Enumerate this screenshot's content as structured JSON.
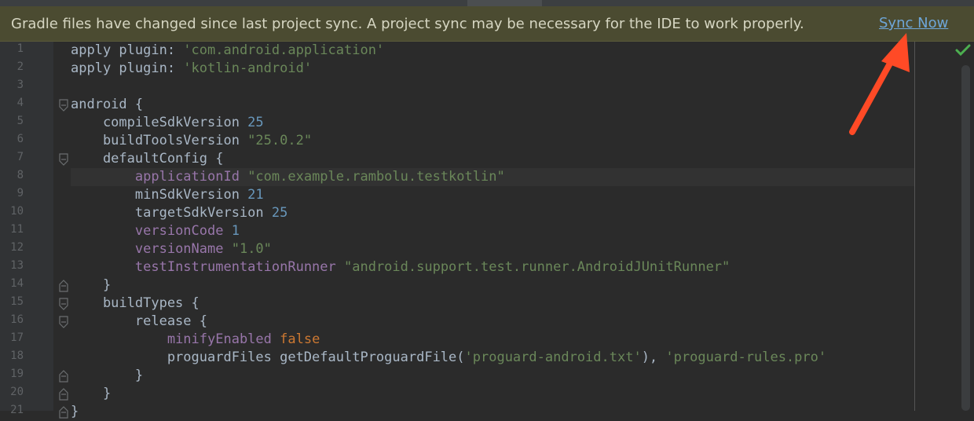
{
  "notification": {
    "message": "Gradle files have changed since last project sync. A project sync may be necessary for the IDE to work properly.",
    "action_label": "Sync Now"
  },
  "colors": {
    "keyword": "#cc7832",
    "string": "#6a8759",
    "number": "#6897bb",
    "property": "#9876aa",
    "plain": "#a9b7c6",
    "annotation_arrow": "#ff4a26"
  },
  "icons": {
    "status": "check-icon",
    "fold": "fold-marker-icon",
    "annotation": "red-arrow-icon"
  },
  "current_line": 8,
  "lines": [
    {
      "num": "1",
      "fold": "",
      "tokens": [
        {
          "t": "apply plugin: ",
          "c": ""
        },
        {
          "t": "'com.android.application'",
          "c": "str"
        }
      ]
    },
    {
      "num": "2",
      "fold": "",
      "tokens": [
        {
          "t": "apply plugin: ",
          "c": ""
        },
        {
          "t": "'kotlin-android'",
          "c": "str"
        }
      ]
    },
    {
      "num": "3",
      "fold": "",
      "tokens": []
    },
    {
      "num": "4",
      "fold": "open",
      "tokens": [
        {
          "t": "android {",
          "c": ""
        }
      ]
    },
    {
      "num": "5",
      "fold": "",
      "tokens": [
        {
          "t": "    compileSdkVersion ",
          "c": ""
        },
        {
          "t": "25",
          "c": "num"
        }
      ]
    },
    {
      "num": "6",
      "fold": "",
      "tokens": [
        {
          "t": "    buildToolsVersion ",
          "c": ""
        },
        {
          "t": "\"25.0.2\"",
          "c": "str"
        }
      ]
    },
    {
      "num": "7",
      "fold": "open",
      "tokens": [
        {
          "t": "    defaultConfig {",
          "c": ""
        }
      ]
    },
    {
      "num": "8",
      "fold": "",
      "tokens": [
        {
          "t": "        ",
          "c": ""
        },
        {
          "t": "applicationId ",
          "c": "prop"
        },
        {
          "t": "\"com.example.rambolu.testkotlin\"",
          "c": "str"
        }
      ]
    },
    {
      "num": "9",
      "fold": "",
      "tokens": [
        {
          "t": "        minSdkVersion ",
          "c": ""
        },
        {
          "t": "21",
          "c": "num"
        }
      ]
    },
    {
      "num": "10",
      "fold": "",
      "tokens": [
        {
          "t": "        targetSdkVersion ",
          "c": ""
        },
        {
          "t": "25",
          "c": "num"
        }
      ]
    },
    {
      "num": "11",
      "fold": "",
      "tokens": [
        {
          "t": "        ",
          "c": ""
        },
        {
          "t": "versionCode ",
          "c": "prop"
        },
        {
          "t": "1",
          "c": "num"
        }
      ]
    },
    {
      "num": "12",
      "fold": "",
      "tokens": [
        {
          "t": "        ",
          "c": ""
        },
        {
          "t": "versionName ",
          "c": "prop"
        },
        {
          "t": "\"1.0\"",
          "c": "str"
        }
      ]
    },
    {
      "num": "13",
      "fold": "",
      "tokens": [
        {
          "t": "        ",
          "c": ""
        },
        {
          "t": "testInstrumentationRunner ",
          "c": "prop"
        },
        {
          "t": "\"android.support.test.runner.AndroidJUnitRunner\"",
          "c": "str"
        }
      ]
    },
    {
      "num": "14",
      "fold": "close",
      "tokens": [
        {
          "t": "    }",
          "c": ""
        }
      ]
    },
    {
      "num": "15",
      "fold": "open",
      "tokens": [
        {
          "t": "    buildTypes {",
          "c": ""
        }
      ]
    },
    {
      "num": "16",
      "fold": "open",
      "tokens": [
        {
          "t": "        release {",
          "c": ""
        }
      ]
    },
    {
      "num": "17",
      "fold": "",
      "tokens": [
        {
          "t": "            ",
          "c": ""
        },
        {
          "t": "minifyEnabled ",
          "c": "prop"
        },
        {
          "t": "false",
          "c": "kw"
        }
      ]
    },
    {
      "num": "18",
      "fold": "",
      "tokens": [
        {
          "t": "            proguardFiles getDefaultProguardFile(",
          "c": ""
        },
        {
          "t": "'proguard-android.txt'",
          "c": "str"
        },
        {
          "t": "), ",
          "c": ""
        },
        {
          "t": "'proguard-rules.pro'",
          "c": "str"
        }
      ]
    },
    {
      "num": "19",
      "fold": "close",
      "tokens": [
        {
          "t": "        }",
          "c": ""
        }
      ]
    },
    {
      "num": "20",
      "fold": "close",
      "tokens": [
        {
          "t": "    }",
          "c": ""
        }
      ]
    },
    {
      "num": "21",
      "fold": "close",
      "tokens": [
        {
          "t": "}",
          "c": ""
        }
      ]
    }
  ]
}
